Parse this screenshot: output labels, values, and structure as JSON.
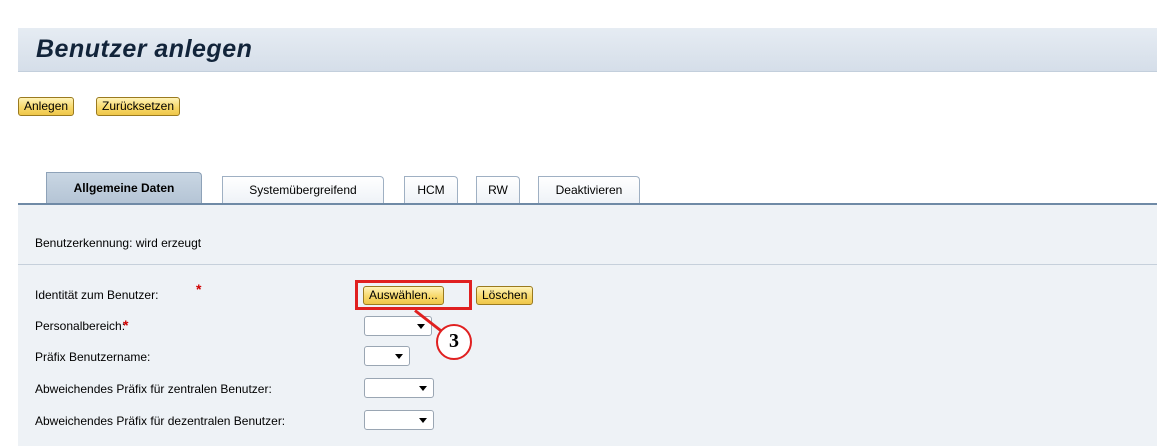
{
  "page": {
    "title": "Benutzer anlegen"
  },
  "toolbar": {
    "create_label": "Anlegen",
    "reset_label": "Zurücksetzen"
  },
  "tabs": [
    {
      "label": "Allgemeine Daten",
      "active": true
    },
    {
      "label": "Systemübergreifend",
      "active": false
    },
    {
      "label": "HCM",
      "active": false
    },
    {
      "label": "RW",
      "active": false
    },
    {
      "label": "Deaktivieren",
      "active": false
    }
  ],
  "form": {
    "user_id_text": "Benutzerkennung: wird erzeugt",
    "identity_label": "Identität zum Benutzer:",
    "required_marker": "*",
    "select_button": "Auswählen...",
    "delete_button": "Löschen",
    "personnel_area_label": "Personalbereich:",
    "prefix_label": "Präfix Benutzername:",
    "central_prefix_label": "Abweichendes Präfix für zentralen Benutzer:",
    "decentral_prefix_label": "Abweichendes Präfix für dezentralen Benutzer:"
  },
  "annotation": {
    "step_number": "3",
    "color": "#e02020"
  },
  "colors": {
    "button_accent": "#f7d86b",
    "title_bar": "#d5dee9",
    "panel_bg": "#eef2f6"
  }
}
